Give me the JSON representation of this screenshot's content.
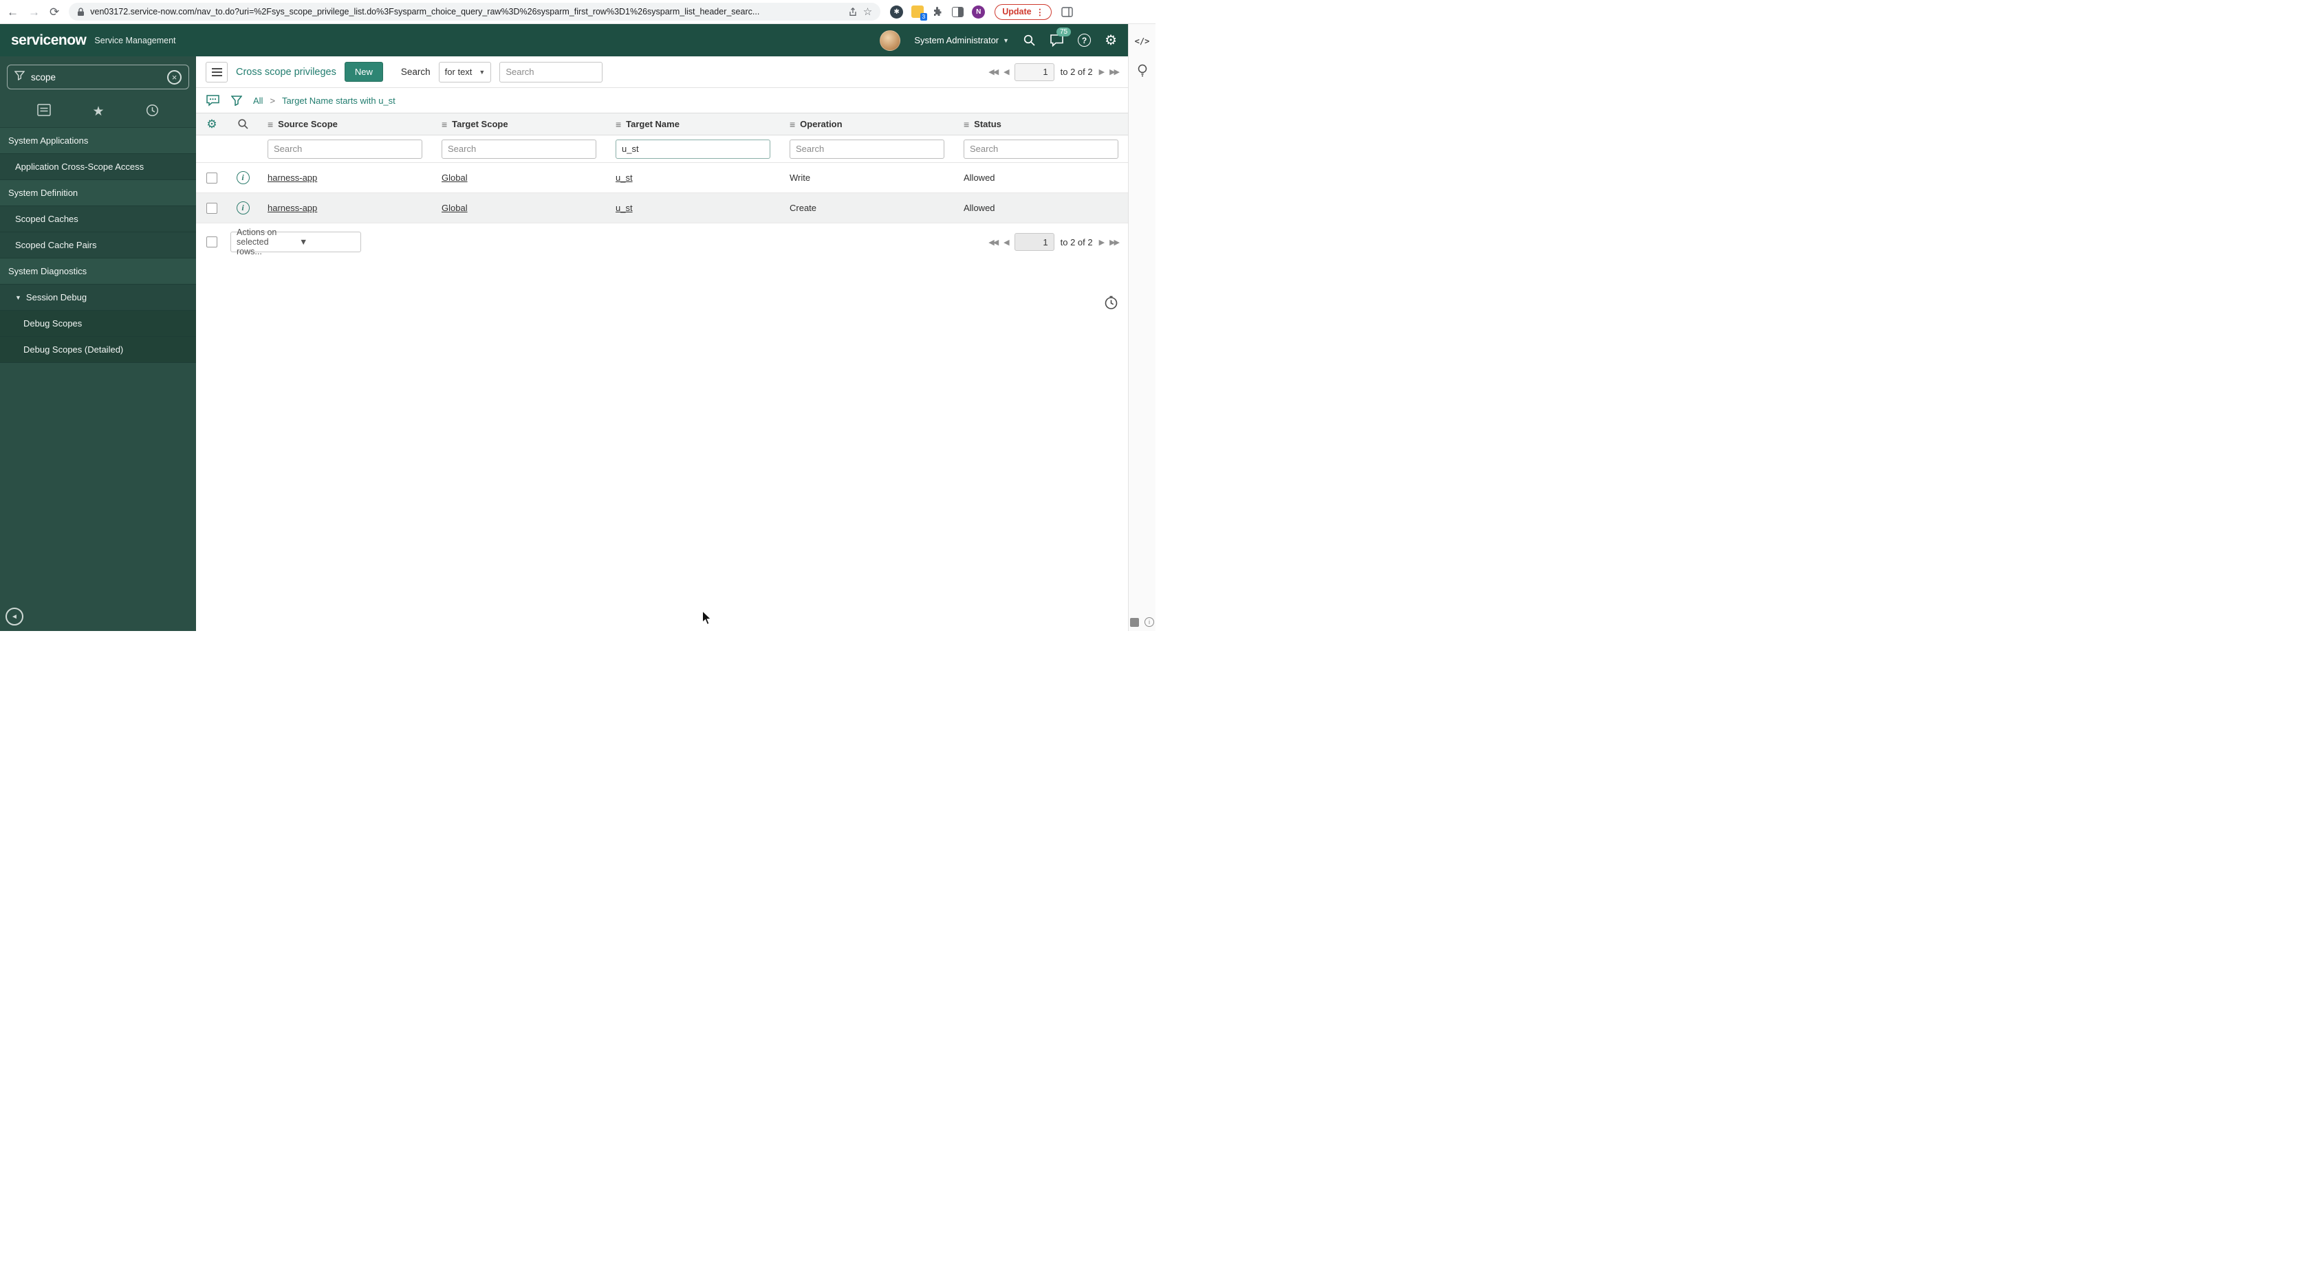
{
  "browser": {
    "url": "ven03172.service-now.com/nav_to.do?uri=%2Fsys_scope_privilege_list.do%3Fsysparm_choice_query_raw%3D%26sysparm_first_row%3D1%26sysparm_list_header_searc...",
    "update_label": "Update",
    "extension_badge": "3",
    "profile_letter": "N"
  },
  "banner": {
    "logo": "servicenow",
    "product": "Service Management",
    "user_name": "System Administrator",
    "notification_count": "75"
  },
  "sidebar": {
    "filter_value": "scope",
    "items": [
      {
        "label": "System Applications"
      },
      {
        "label": "Application Cross-Scope Access"
      },
      {
        "label": "System Definition"
      },
      {
        "label": "Scoped Caches"
      },
      {
        "label": "Scoped Cache Pairs"
      },
      {
        "label": "System Diagnostics"
      },
      {
        "label": "Session Debug"
      },
      {
        "label": "Debug Scopes"
      },
      {
        "label": "Debug Scopes (Detailed)"
      }
    ]
  },
  "toolbar": {
    "title": "Cross scope privileges",
    "new_button": "New",
    "search_label": "Search",
    "search_type": "for text",
    "search_placeholder": "Search"
  },
  "pagination": {
    "page": "1",
    "range": "to 2 of 2"
  },
  "breadcrumb": {
    "all": "All",
    "separator": ">",
    "filter": "Target Name starts with u_st"
  },
  "list": {
    "columns": [
      "Source Scope",
      "Target Scope",
      "Target Name",
      "Operation",
      "Status"
    ],
    "search_placeholder": "Search",
    "target_name_search": "u_st",
    "rows": [
      {
        "source_scope": "harness-app",
        "target_scope": "Global",
        "target_name": "u_st",
        "operation": "Write",
        "status": "Allowed"
      },
      {
        "source_scope": "harness-app",
        "target_scope": "Global",
        "target_name": "u_st",
        "operation": "Create",
        "status": "Allowed"
      }
    ],
    "actions_placeholder": "Actions on selected rows..."
  },
  "colors": {
    "banner_green": "#1e4e42",
    "accent_teal": "#2e8573",
    "link_teal": "#227d6f",
    "update_red": "#cf3a2f",
    "badge_teal": "#63b39c"
  }
}
